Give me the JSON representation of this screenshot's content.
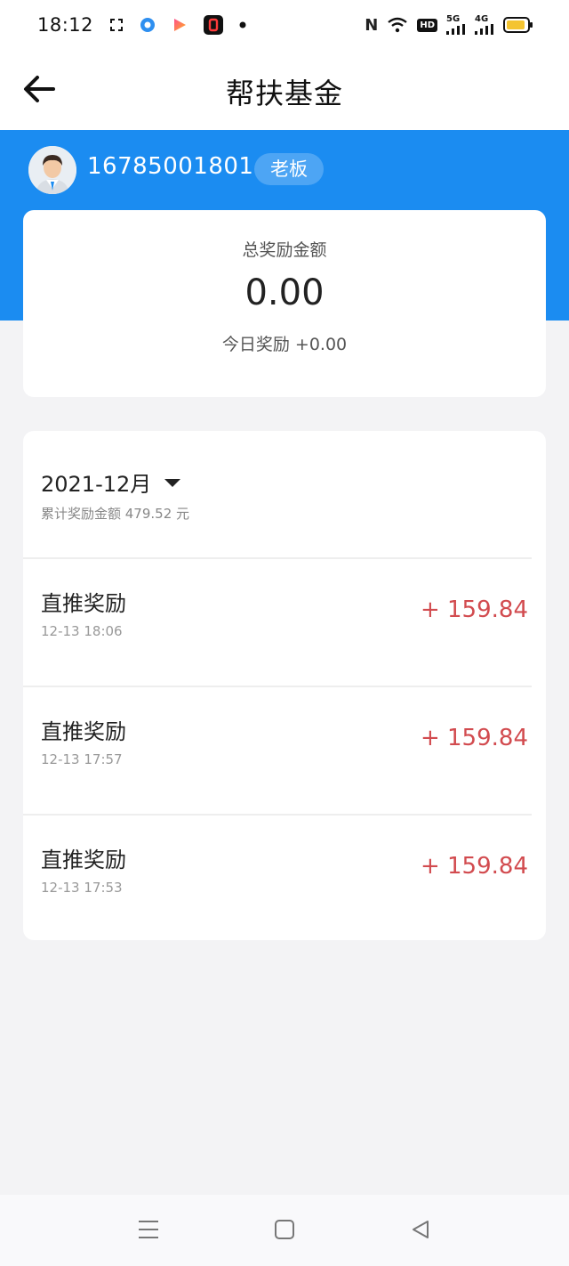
{
  "status_bar": {
    "time": "18:12",
    "icons_left": [
      "screenshot-icon",
      "browser-icon",
      "video-app-icon",
      "app-icon",
      "notification-dot-icon"
    ],
    "nfc": "N",
    "hd_label": "HD",
    "net1": "5G",
    "net2": "4G"
  },
  "nav": {
    "back_icon": "arrow-left-icon",
    "title": "帮扶基金"
  },
  "user": {
    "phone": "16785001801",
    "role": "老板"
  },
  "summary": {
    "label": "总奖励金额",
    "total": "0.00",
    "today": "今日奖励 +0.00"
  },
  "records": {
    "month": "2021-12月",
    "month_total": "累计奖励金额 479.52 元",
    "items": [
      {
        "title": "直推奖励",
        "time": "12-13 18:06",
        "amount": "+ 159.84"
      },
      {
        "title": "直推奖励",
        "time": "12-13 17:57",
        "amount": "+ 159.84"
      },
      {
        "title": "直推奖励",
        "time": "12-13 17:53",
        "amount": "+ 159.84"
      }
    ]
  },
  "bottom_nav": [
    "menu-icon",
    "home-square-icon",
    "back-triangle-icon"
  ],
  "colors": {
    "brand_blue": "#1b8cf1",
    "amount_red": "#d24b4f",
    "background": "#f3f3f5"
  }
}
